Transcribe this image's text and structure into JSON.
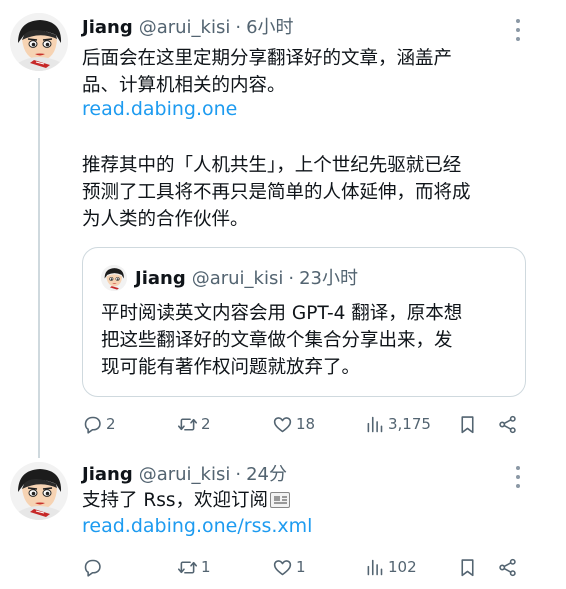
{
  "tweets": [
    {
      "author": {
        "name": "Jiang",
        "handle": "@arui_kisi",
        "separator": "·",
        "time": "6小时"
      },
      "body": {
        "line1": "后面会在这里定期分享翻译好的文章，涵盖产",
        "line2": "品、计算机相关的内容。",
        "link": "read.dabing.one",
        "line3": "推荐其中的「人机共生」，上个世纪先驱就已经",
        "line4": "预测了工具将不再只是简单的人体延伸，而将成",
        "line5": "为人类的合作伙伴。"
      },
      "quote": {
        "author": {
          "name": "Jiang",
          "handle": "@arui_kisi",
          "separator": "·",
          "time": "23小时"
        },
        "line1": "平时阅读英文内容会用 GPT-4 翻译，原本想",
        "line2": "把这些翻译好的文章做个集合分享出来，发",
        "line3": "现可能有著作权问题就放弃了。"
      },
      "actions": {
        "replies": "2",
        "retweets": "2",
        "likes": "18",
        "views": "3,175"
      }
    },
    {
      "author": {
        "name": "Jiang",
        "handle": "@arui_kisi",
        "separator": "·",
        "time": "24分"
      },
      "body": {
        "line1": "支持了 Rss，欢迎订阅",
        "link": "read.dabing.one/rss.xml"
      },
      "actions": {
        "replies": "",
        "retweets": "1",
        "likes": "1",
        "views": "102"
      }
    }
  ],
  "icons": {
    "reply": "reply-icon",
    "retweet": "retweet-icon",
    "like": "heart-icon",
    "views": "views-icon",
    "bookmark": "bookmark-icon",
    "share": "share-icon",
    "more": "more-icon",
    "newspaper": "newspaper-emoji"
  },
  "colors": {
    "link": "#1d9bf0",
    "secondary": "#536471",
    "border": "#cfd9de"
  }
}
